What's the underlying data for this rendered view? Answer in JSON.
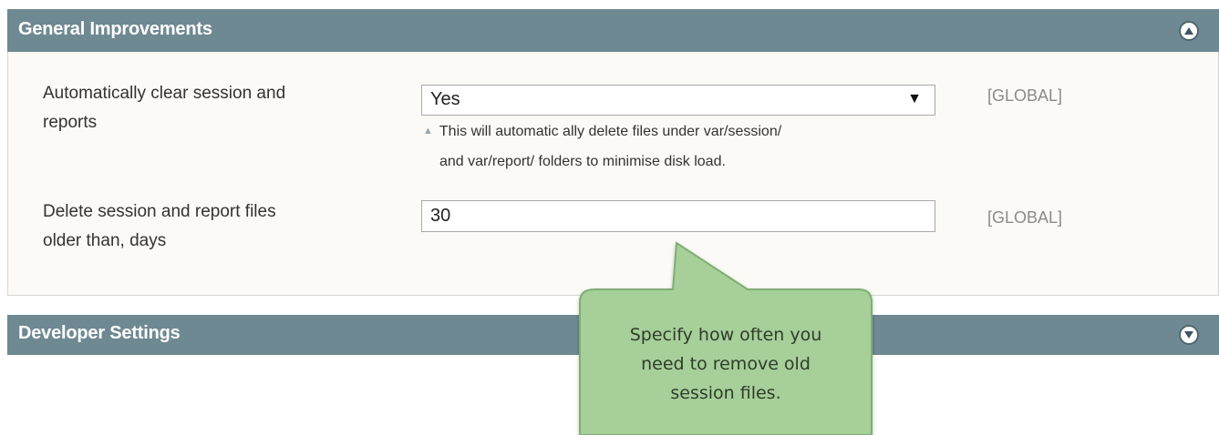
{
  "general": {
    "title": "General Improvements",
    "fields": {
      "auto_clear": {
        "label_line1": "Automatically clear session and",
        "label_line2": "reports",
        "value": "Yes",
        "hint_line1": "This will automatic ally delete files under var/session/",
        "hint_line2": "and var/report/ folders to minimise disk load.",
        "scope": "[GLOBAL]"
      },
      "delete_older": {
        "label_line1": "Delete session and report files",
        "label_line2": "older than, days",
        "value": "30",
        "scope": "[GLOBAL]"
      }
    },
    "toggle_icon": "collapse-up-icon"
  },
  "developer": {
    "title": "Developer Settings",
    "toggle_icon": "expand-down-icon"
  },
  "callout": {
    "line1": "Specify how often you",
    "line2": "need to remove old",
    "line3": "session files."
  },
  "colors": {
    "header_bg": "#6f8992",
    "panel_bg": "#fbfaf6",
    "callout_bg": "#a6cf9a",
    "callout_border": "#7fae72"
  }
}
